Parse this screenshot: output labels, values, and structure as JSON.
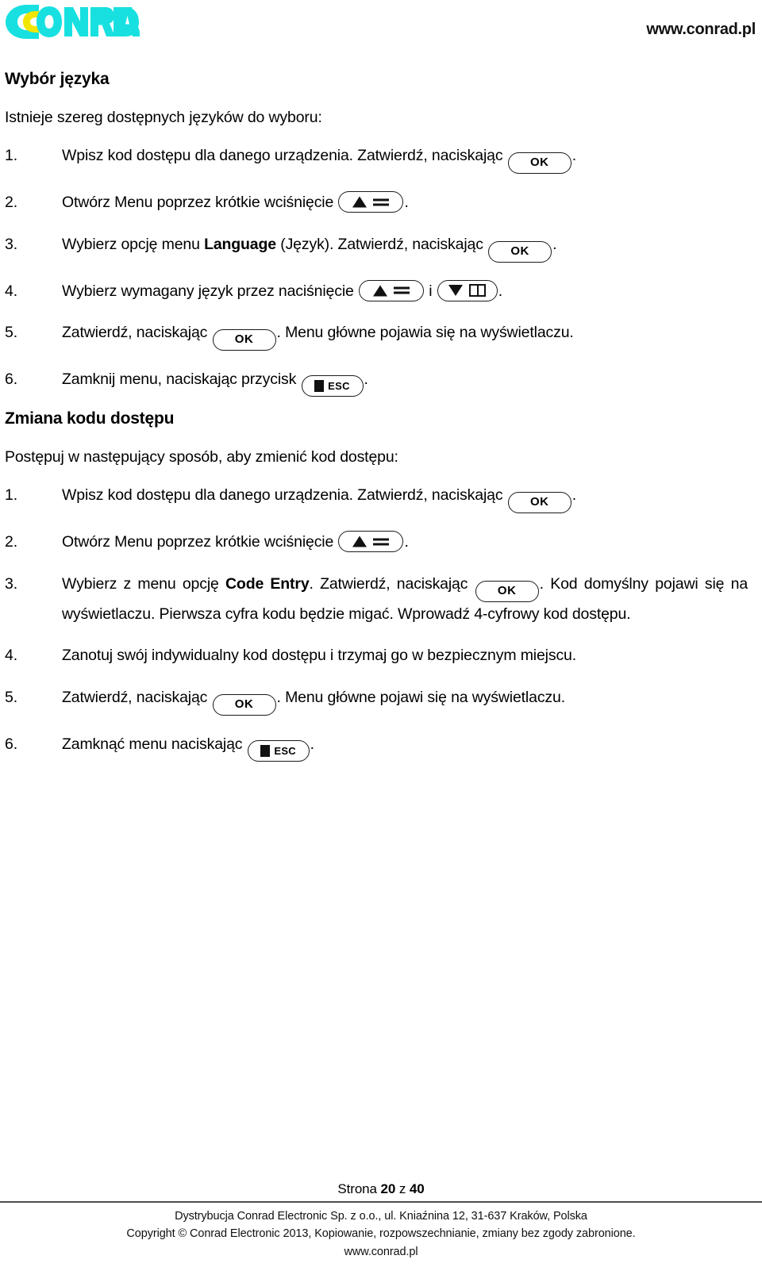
{
  "header": {
    "logo_text": "CONRAD",
    "logo_colors": {
      "primary": "#18E0E0",
      "accent": "#F2E600"
    },
    "url": "www.conrad.pl"
  },
  "sections": [
    {
      "title": "Wybór języka",
      "lead": "Istnieje szereg dostępnych języków do wyboru:",
      "steps": [
        {
          "num": "1.",
          "parts": [
            "Wpisz kod dostępu dla danego urządzenia. Zatwierdź, naciskając ",
            "{OK}",
            "."
          ]
        },
        {
          "num": "2.",
          "parts": [
            "Otwórz Menu poprzez krótkie wciśnięcie ",
            "{MENU}",
            "."
          ]
        },
        {
          "num": "3.",
          "parts": [
            "Wybierz opcję menu ",
            "{B:Language}",
            " (Język). Zatwierdź, naciskając ",
            "{OK}",
            "."
          ]
        },
        {
          "num": "4.",
          "parts": [
            "Wybierz wymagany język przez naciśnięcie ",
            "{MENU}",
            " i ",
            "{BOOK}",
            "."
          ]
        },
        {
          "num": "5.",
          "parts": [
            "Zatwierdź, naciskając ",
            "{OK}",
            ". Menu główne pojawia się na wyświetlaczu."
          ]
        },
        {
          "num": "6.",
          "parts": [
            "Zamknij menu, naciskając przycisk ",
            "{ESC}",
            "."
          ]
        }
      ]
    },
    {
      "title": "Zmiana kodu dostępu",
      "lead": "Postępuj w następujący sposób, aby zmienić kod dostępu:",
      "steps": [
        {
          "num": "1.",
          "parts": [
            "Wpisz kod dostępu dla danego urządzenia. Zatwierdź, naciskając ",
            "{OK}",
            "."
          ]
        },
        {
          "num": "2.",
          "parts": [
            "Otwórz Menu poprzez krótkie wciśnięcie ",
            "{MENU}",
            "."
          ]
        },
        {
          "num": "3.",
          "justified": true,
          "parts": [
            "Wybierz z menu opcję ",
            "{B:Code Entry}",
            ". Zatwierdź, naciskając ",
            "{OK}",
            ". Kod domyślny pojawi się na wyświetlaczu. Pierwsza cyfra kodu będzie migać. Wprowadź 4-cyfrowy kod dostępu."
          ]
        },
        {
          "num": "4.",
          "parts": [
            "Zanotuj swój indywidualny kod dostępu i trzymaj go w bezpiecznym miejscu."
          ]
        },
        {
          "num": "5.",
          "parts": [
            "Zatwierdź, naciskając ",
            "{OK}",
            ". Menu główne pojawi się na wyświetlaczu."
          ]
        },
        {
          "num": "6.",
          "parts": [
            "Zamknąć menu naciskając ",
            "{ESC}",
            "."
          ]
        }
      ]
    }
  ],
  "keys": {
    "ok_label": "OK",
    "esc_label": "ESC",
    "menu_label": "up-triangle-and-lines",
    "book_label": "down-triangle-and-book"
  },
  "footer": {
    "page_prefix": "Strona ",
    "page_current": "20",
    "page_mid": " z ",
    "page_total": "40",
    "line1": "Dystrybucja Conrad Electronic Sp. z o.o., ul. Kniaźnina 12, 31-637 Kraków, Polska",
    "line2": "Copyright © Conrad Electronic 2013, Kopiowanie, rozpowszechnianie, zmiany bez zgody zabronione.",
    "line3": "www.conrad.pl"
  }
}
